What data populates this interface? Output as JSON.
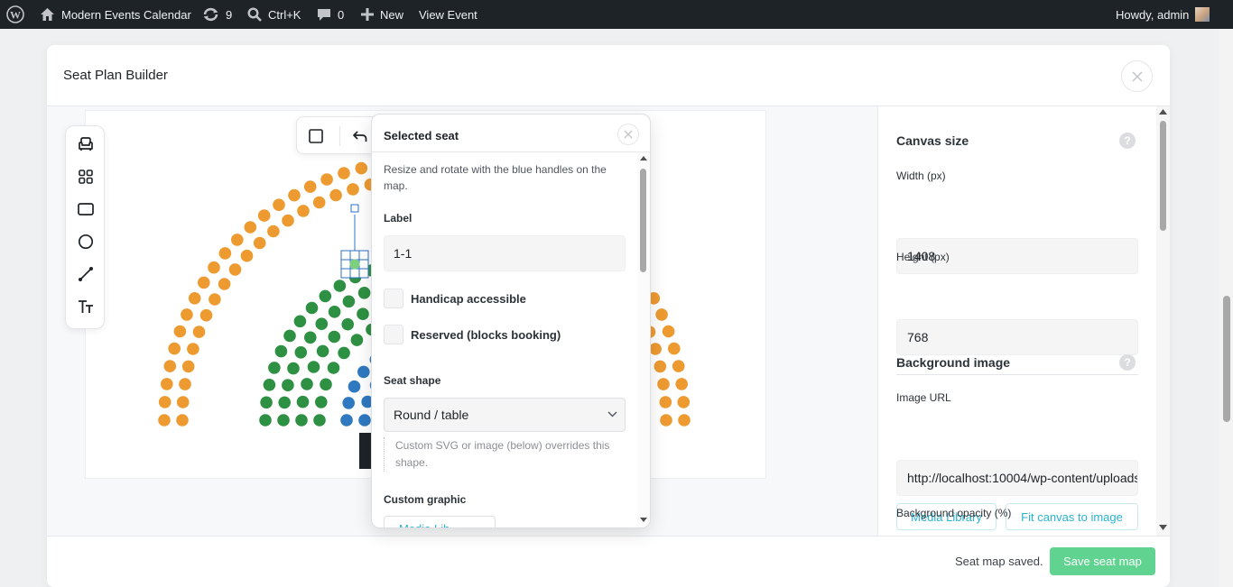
{
  "admin_bar": {
    "site_name": "Modern Events Calendar",
    "updates_count": "9",
    "search_shortcut": "Ctrl+K",
    "comments_count": "0",
    "new_label": "New",
    "view_event_label": "View Event",
    "greeting": "Howdy, admin"
  },
  "modal": {
    "title": "Seat Plan Builder"
  },
  "canvas": {
    "seat_colors": {
      "outer": "#ed9a31",
      "middle": "#2e9043",
      "inner": "#2f79c0",
      "selected": "#7dd17e",
      "selection_handle": "#2e71c5"
    }
  },
  "toolbar": {
    "tools": [
      "seat-tool",
      "grid-tool",
      "rectangle-tool",
      "circle-tool",
      "line-tool",
      "text-tool"
    ]
  },
  "popover": {
    "title": "Selected seat",
    "hint": "Resize and rotate with the blue handles on the map.",
    "label_heading": "Label",
    "label_value": "1-1",
    "handicap_label": "Handicap accessible",
    "reserved_label": "Reserved (blocks booking)",
    "seat_shape_heading": "Seat shape",
    "seat_shape_value": "Round / table",
    "seat_shape_hint": "Custom SVG or image (below) overrides this shape.",
    "custom_graphic_heading": "Custom graphic",
    "media_button_partial": "Media Lib"
  },
  "sidebar": {
    "canvas_size_heading": "Canvas size",
    "width_label": "Width (px)",
    "width_value": "1408",
    "height_label": "Height (px)",
    "height_value": "768",
    "background_image_heading": "Background image",
    "image_url_label": "Image URL",
    "image_url_value": "http://localhost:10004/wp-content/uploads/",
    "media_library_button": "Media Library",
    "fit_canvas_button": "Fit canvas to image",
    "opacity_label": "Background opacity (%)",
    "help_glyph": "?"
  },
  "footer": {
    "status_text": "Seat map saved.",
    "save_button": "Save seat map"
  }
}
